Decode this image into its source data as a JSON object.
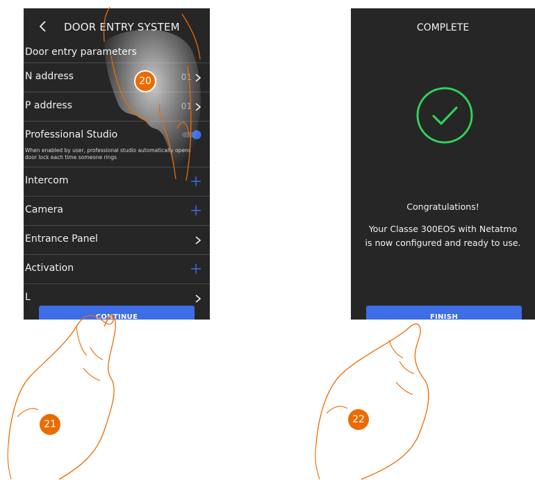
{
  "left_screen": {
    "title": "DOOR ENTRY SYSTEM",
    "section_label": "Door entry parameters",
    "rows": [
      {
        "label": "N address",
        "value": "01",
        "control": "chevron"
      },
      {
        "label": "P address",
        "value": "01",
        "control": "chevron"
      },
      {
        "label": "Professional Studio",
        "description": "When enabled by user, professional studio automatically opens door lock each time someone rings",
        "control": "toggle",
        "toggle_on": true
      },
      {
        "label": "Intercom",
        "control": "plus"
      },
      {
        "label": "Camera",
        "control": "plus"
      },
      {
        "label": "Entrance Panel",
        "control": "chevron"
      },
      {
        "label": "Activation",
        "control": "plus"
      },
      {
        "label": "L",
        "control": "chevron"
      }
    ],
    "continue_label": "CONTINUE"
  },
  "right_screen": {
    "title": "COMPLETE",
    "congrats": "Congratulations!",
    "message_line1": "Your Classe 300EOS with Netatmo",
    "message_line2": "is now configured and ready to use.",
    "finish_label": "FINISH"
  },
  "steps": {
    "step1": "20",
    "step2": "21",
    "step3": "22"
  },
  "colors": {
    "screen_bg": "#262626",
    "accent": "#3d6ee6",
    "check": "#2fd35a",
    "badge": "#ec6b00"
  }
}
